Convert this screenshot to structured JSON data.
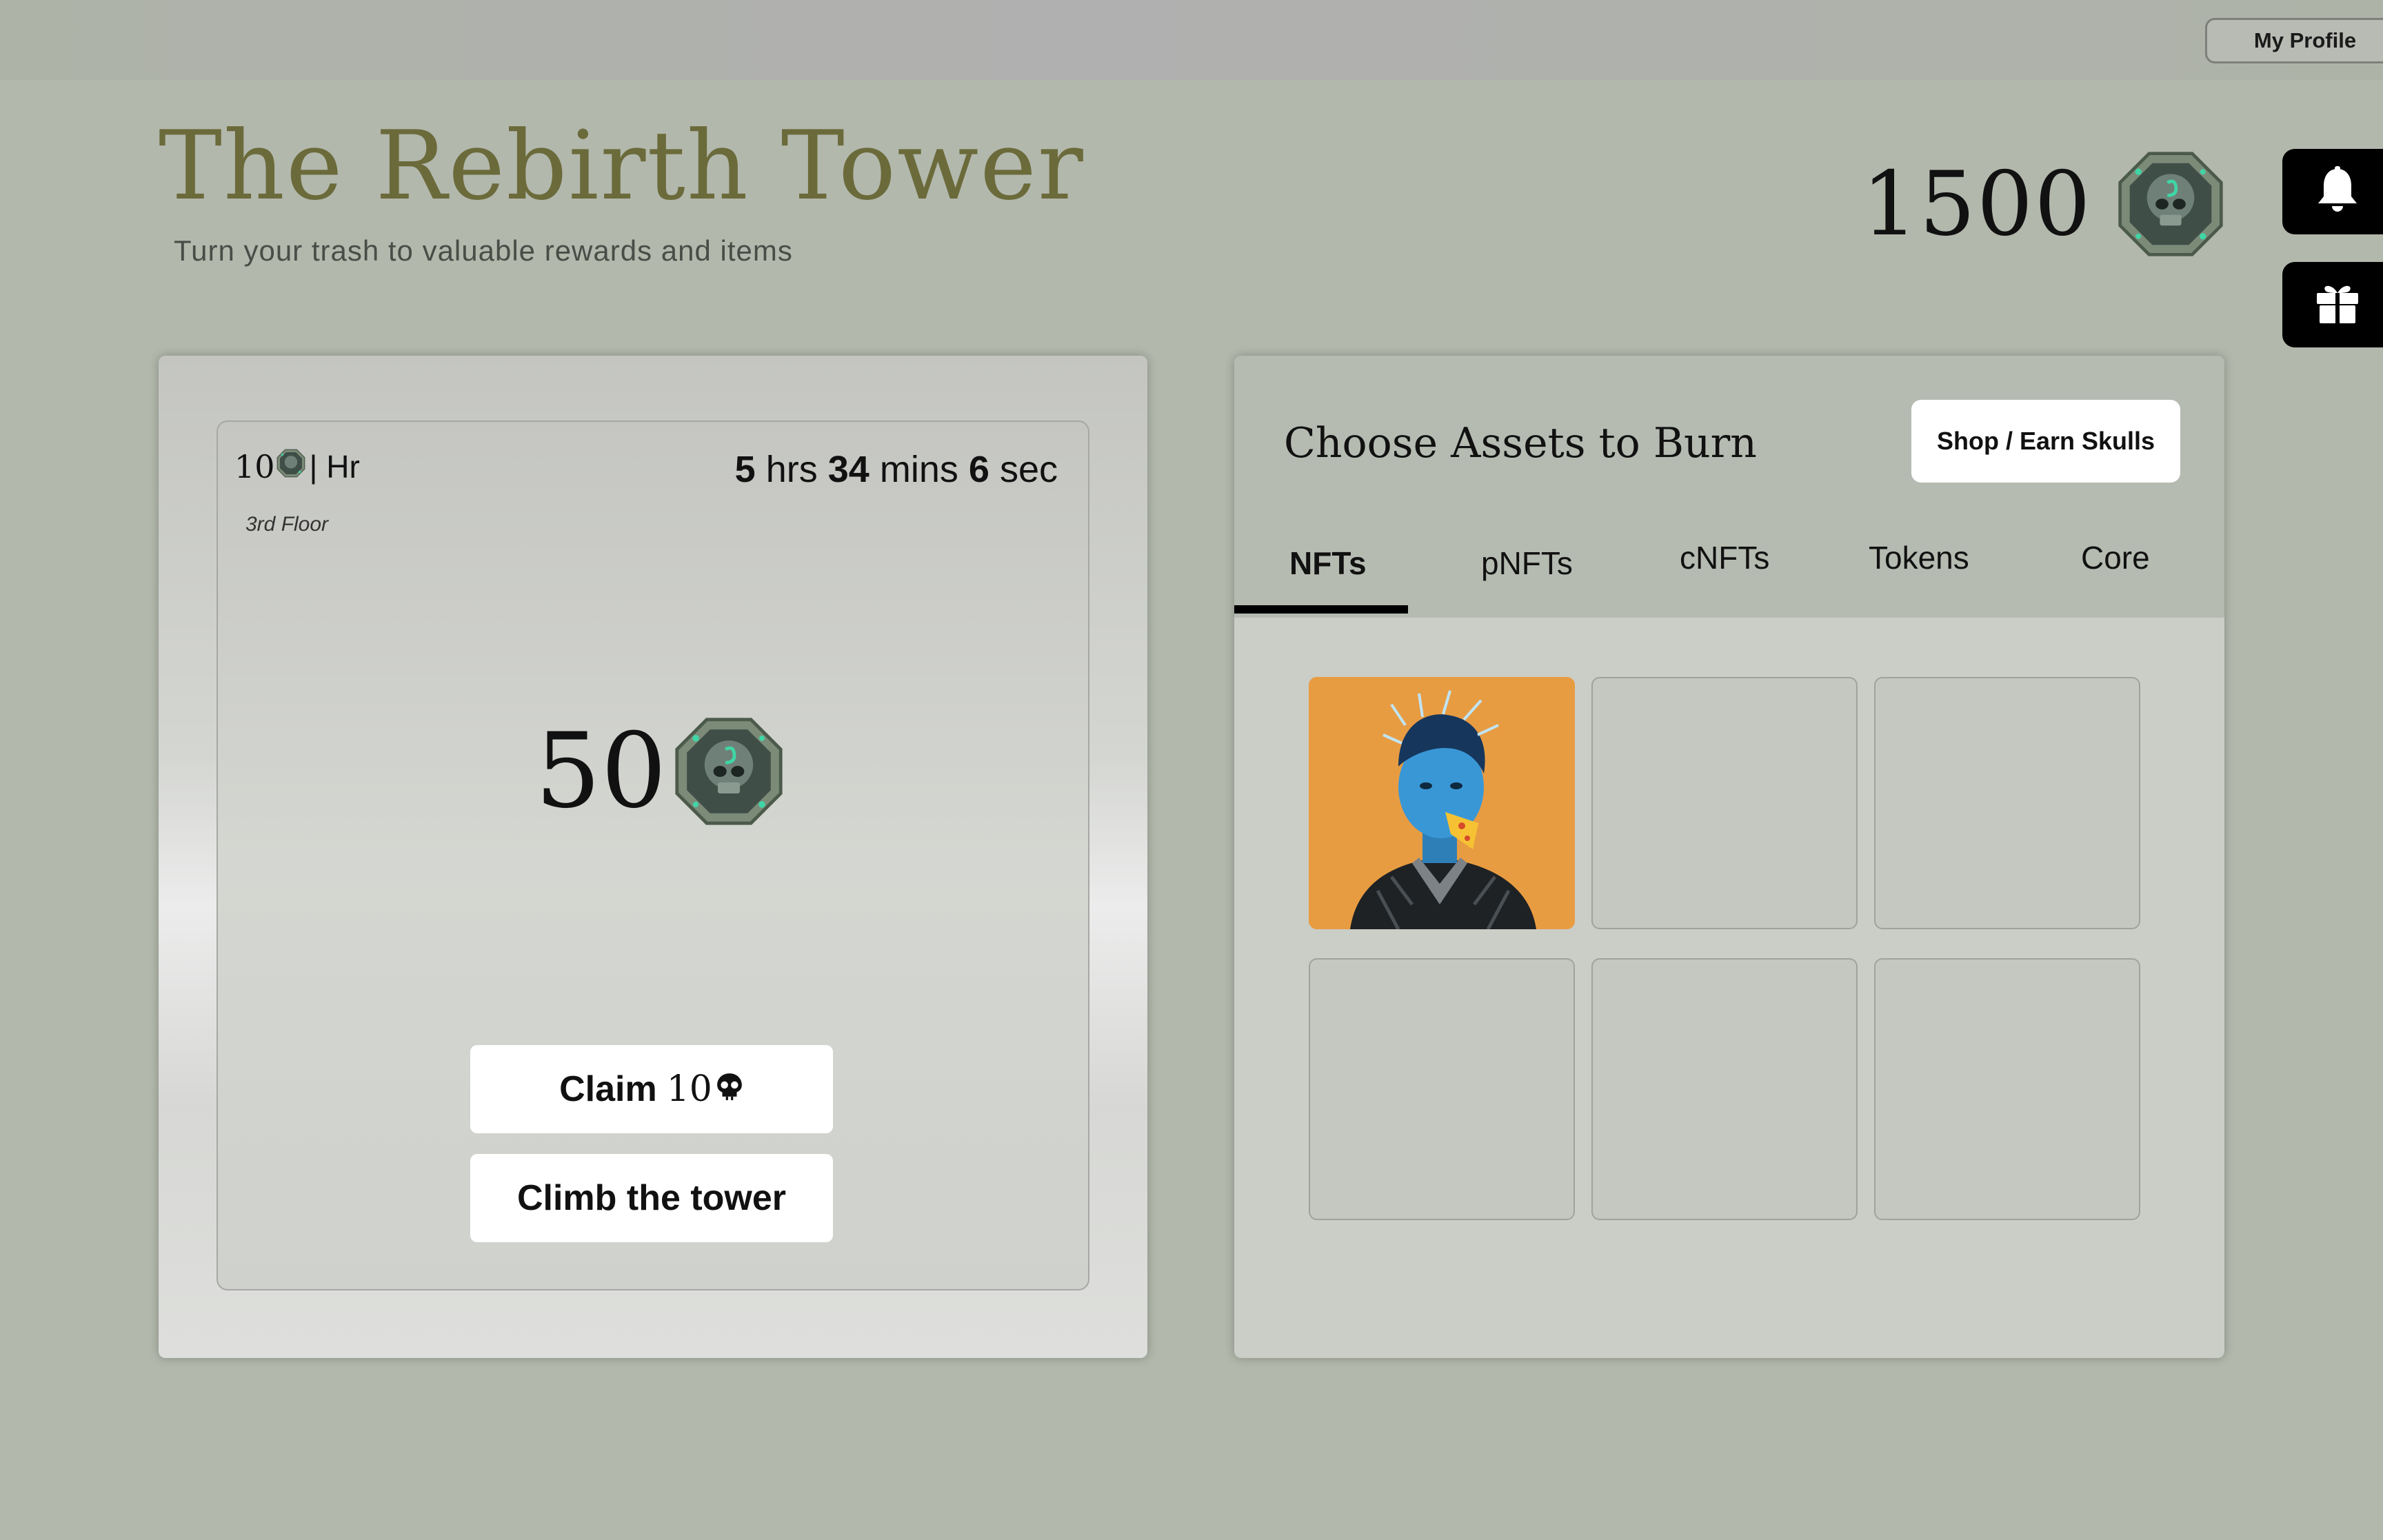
{
  "header": {
    "profile_label": "My Profile",
    "title": "The Rebirth Tower",
    "subtitle": "Turn your trash to valuable rewards and items",
    "balance": "1500"
  },
  "sidebar": {
    "notifications_icon": "bell-icon",
    "gift_icon": "gift-icon"
  },
  "tower": {
    "rate_value": "10",
    "rate_unit": "| Hr",
    "floor": "3rd Floor",
    "timer": {
      "hours": "5",
      "hours_label": "hrs",
      "minutes": "34",
      "minutes_label": "mins",
      "seconds": "6",
      "seconds_label": "sec"
    },
    "reward_value": "50",
    "claim_label": "Claim",
    "claim_value": "10",
    "climb_label": "Climb the tower"
  },
  "burn": {
    "title": "Choose Assets to Burn",
    "shop_label": "Shop / Earn Skulls",
    "tabs": [
      {
        "label": "NFTs",
        "active": true
      },
      {
        "label": "pNFTs",
        "active": false
      },
      {
        "label": "cNFTs",
        "active": false
      },
      {
        "label": "Tokens",
        "active": false
      },
      {
        "label": "Core",
        "active": false
      }
    ]
  },
  "colors": {
    "background": "#b2b8ac",
    "title": "#6b6a3a",
    "nft_background": "#e89c42",
    "coin_teal": "#3fd6a6"
  }
}
